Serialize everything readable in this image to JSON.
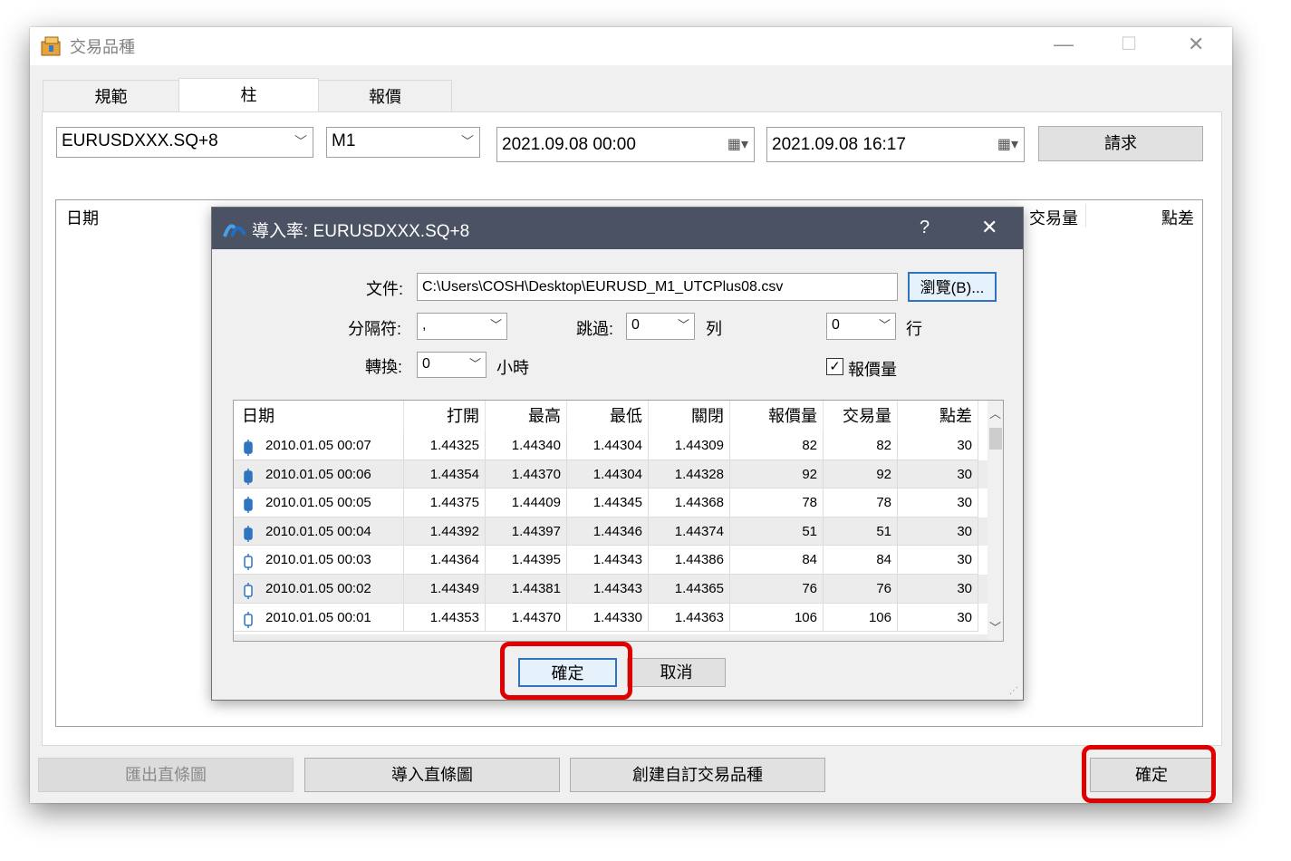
{
  "window": {
    "title": "交易品種",
    "minimize": "—",
    "maximize": "☐",
    "close": "✕"
  },
  "tabs": [
    {
      "label": "規範"
    },
    {
      "label": "柱"
    },
    {
      "label": "報價"
    }
  ],
  "toolbar": {
    "symbol": "EURUSDXXX.SQ+8",
    "timeframe": "M1",
    "date_from": "2021.09.08 00:00",
    "date_to": "2021.09.08 16:17",
    "request_label": "請求"
  },
  "main_list": {
    "columns": [
      "日期",
      "交易量",
      "點差"
    ]
  },
  "bottom": {
    "export_label": "匯出直條圖",
    "import_label": "導入直條圖",
    "create_label": "創建自訂交易品種",
    "ok_label": "確定"
  },
  "dialog": {
    "title": "導入率: EURUSDXXX.SQ+8",
    "help": "?",
    "close": "✕",
    "file_label": "文件:",
    "file_value": "C:\\Users\\COSH\\Desktop\\EURUSD_M1_UTCPlus08.csv",
    "browse_label": "瀏覽(B)...",
    "separator_label": "分隔符:",
    "separator_value": ",",
    "skip_label": "跳過:",
    "skip_cols_value": "0",
    "cols_unit": "列",
    "skip_rows_value": "0",
    "rows_unit": "行",
    "shift_label": "轉換:",
    "shift_value": "0",
    "shift_unit": "小時",
    "tick_volume_label": "報價量",
    "tick_volume_checked": true,
    "ok_label": "確定",
    "cancel_label": "取消"
  },
  "grid": {
    "columns": [
      "日期",
      "打開",
      "最高",
      "最低",
      "關閉",
      "報價量",
      "交易量",
      "點差"
    ],
    "rows": [
      {
        "date": "2010.01.05 00:07",
        "open": "1.44325",
        "high": "1.44340",
        "low": "1.44304",
        "close": "1.44309",
        "tick": "82",
        "vol": "82",
        "spread": "30",
        "bear": true
      },
      {
        "date": "2010.01.05 00:06",
        "open": "1.44354",
        "high": "1.44370",
        "low": "1.44304",
        "close": "1.44328",
        "tick": "92",
        "vol": "92",
        "spread": "30",
        "bear": true
      },
      {
        "date": "2010.01.05 00:05",
        "open": "1.44375",
        "high": "1.44409",
        "low": "1.44345",
        "close": "1.44368",
        "tick": "78",
        "vol": "78",
        "spread": "30",
        "bear": true
      },
      {
        "date": "2010.01.05 00:04",
        "open": "1.44392",
        "high": "1.44397",
        "low": "1.44346",
        "close": "1.44374",
        "tick": "51",
        "vol": "51",
        "spread": "30",
        "bear": true
      },
      {
        "date": "2010.01.05 00:03",
        "open": "1.44364",
        "high": "1.44395",
        "low": "1.44343",
        "close": "1.44386",
        "tick": "84",
        "vol": "84",
        "spread": "30",
        "bear": false
      },
      {
        "date": "2010.01.05 00:02",
        "open": "1.44349",
        "high": "1.44381",
        "low": "1.44343",
        "close": "1.44365",
        "tick": "76",
        "vol": "76",
        "spread": "30",
        "bear": false
      },
      {
        "date": "2010.01.05 00:01",
        "open": "1.44353",
        "high": "1.44370",
        "low": "1.44330",
        "close": "1.44363",
        "tick": "106",
        "vol": "106",
        "spread": "30",
        "bear": false
      }
    ]
  },
  "colors": {
    "accent": "#2f74c0",
    "highlight": "#e00000",
    "dialog_title_bg": "#4a5263"
  }
}
